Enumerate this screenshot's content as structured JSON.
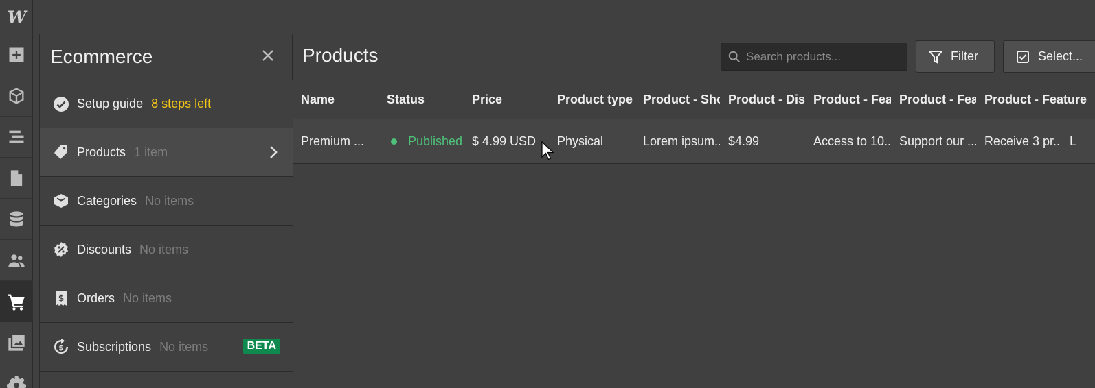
{
  "app": {
    "logo": "W"
  },
  "rail": {
    "icons": [
      "add-icon",
      "cube-icon",
      "navigator-icon",
      "pages-icon",
      "cms-icon",
      "users-icon",
      "cart-icon",
      "assets-icon",
      "settings-icon"
    ],
    "active": "cart-icon"
  },
  "panel": {
    "title": "Ecommerce",
    "setup": {
      "label": "Setup guide",
      "sub": "8 steps left"
    },
    "items": [
      {
        "label": "Products",
        "sub": "1 item"
      },
      {
        "label": "Categories",
        "sub": "No items"
      },
      {
        "label": "Discounts",
        "sub": "No items"
      },
      {
        "label": "Orders",
        "sub": "No items"
      },
      {
        "label": "Subscriptions",
        "sub": "No items",
        "badge": "BETA"
      }
    ]
  },
  "main": {
    "title": "Products",
    "search": {
      "placeholder": "Search products..."
    },
    "filter_label": "Filter",
    "select_label": "Select..."
  },
  "table": {
    "headers": [
      "Name",
      "Status",
      "Price",
      "Product type",
      "Product - Short",
      "Product - Discount",
      "Product - Feature",
      "Product - Feature",
      "Product - Feature"
    ],
    "rows": [
      {
        "name": "Premium ...",
        "status": "Published",
        "price": "$ 4.99 USD",
        "type": "Physical",
        "short": "Lorem ipsum...",
        "discount": "$4.99",
        "feature1": "Access to 10...",
        "feature2": "Support our ...",
        "feature3": "Receive 3 pr...",
        "extra": "L"
      }
    ]
  },
  "colors": {
    "accent_yellow": "#f5c518",
    "status_green": "#4ec27a",
    "beta_green": "#0f8a4f"
  }
}
